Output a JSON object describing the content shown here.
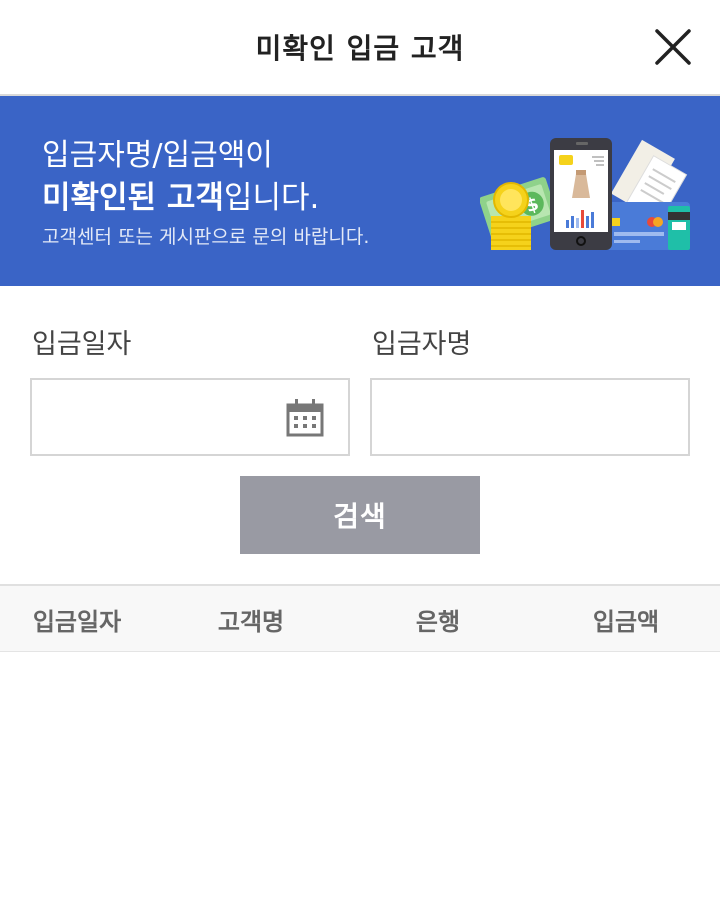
{
  "header": {
    "title": "미확인 입금 고객",
    "close_icon": "close-icon"
  },
  "banner": {
    "line1": "입금자명/입금액이",
    "line2_bold": "미확인된 고객",
    "line2_rest": "입니다.",
    "line3": "고객센터 또는 게시판으로 문의 바랍니다.",
    "illustration_icon": "money-phone-card-illustration",
    "background_color": "#3a64c6"
  },
  "form": {
    "date_label": "입금일자",
    "date_value": "",
    "date_icon": "calendar-icon",
    "name_label": "입금자명",
    "name_value": "",
    "search_label": "검색",
    "search_button_color": "#999aa3"
  },
  "table": {
    "columns": [
      "입금일자",
      "고객명",
      "은행",
      "입금액"
    ],
    "rows": []
  }
}
